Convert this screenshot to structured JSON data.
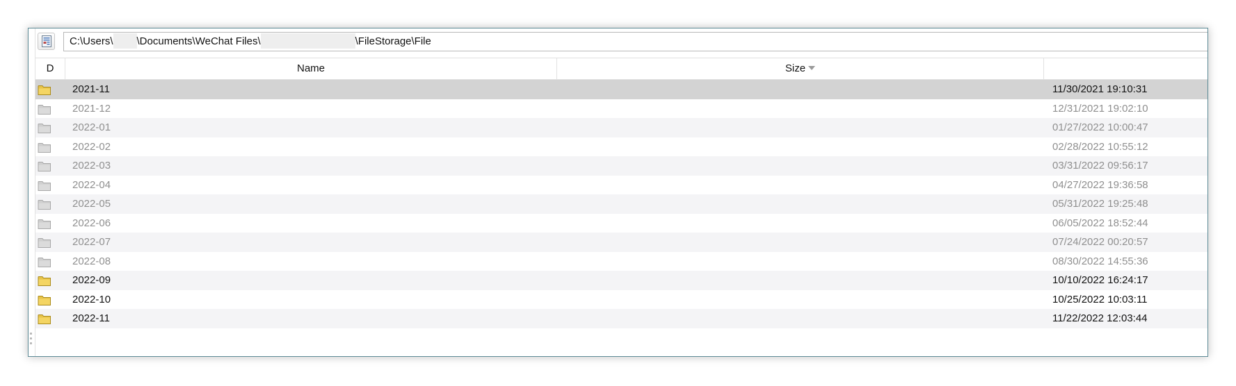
{
  "address_bar": {
    "path_part1": "C:\\Users\\",
    "path_part2": "\\Documents\\WeChat Files\\",
    "path_part3": "\\FileStorage\\File"
  },
  "columns": {
    "d": "D",
    "name": "Name",
    "size": "Size",
    "date": ""
  },
  "sort": {
    "column": "Size",
    "direction": "descending"
  },
  "colors": {
    "folder_normal": "#e8c44a",
    "folder_dim": "#cfcfcf",
    "selected_row": "#d3d3d3",
    "window_border": "#5d8a96"
  },
  "rows": [
    {
      "name": "2021-11",
      "date": "11/30/2021 19:10:31",
      "state": "selected"
    },
    {
      "name": "2021-12",
      "date": "12/31/2021 19:02:10",
      "state": "dim"
    },
    {
      "name": "2022-01",
      "date": "01/27/2022 10:00:47",
      "state": "dim"
    },
    {
      "name": "2022-02",
      "date": "02/28/2022 10:55:12",
      "state": "dim"
    },
    {
      "name": "2022-03",
      "date": "03/31/2022 09:56:17",
      "state": "dim"
    },
    {
      "name": "2022-04",
      "date": "04/27/2022 19:36:58",
      "state": "dim"
    },
    {
      "name": "2022-05",
      "date": "05/31/2022 19:25:48",
      "state": "dim"
    },
    {
      "name": "2022-06",
      "date": "06/05/2022 18:52:44",
      "state": "dim"
    },
    {
      "name": "2022-07",
      "date": "07/24/2022 00:20:57",
      "state": "dim"
    },
    {
      "name": "2022-08",
      "date": "08/30/2022 14:55:36",
      "state": "dim"
    },
    {
      "name": "2022-09",
      "date": "10/10/2022 16:24:17",
      "state": "normal"
    },
    {
      "name": "2022-10",
      "date": "10/25/2022 10:03:11",
      "state": "normal"
    },
    {
      "name": "2022-11",
      "date": "11/22/2022 12:03:44",
      "state": "normal"
    }
  ]
}
